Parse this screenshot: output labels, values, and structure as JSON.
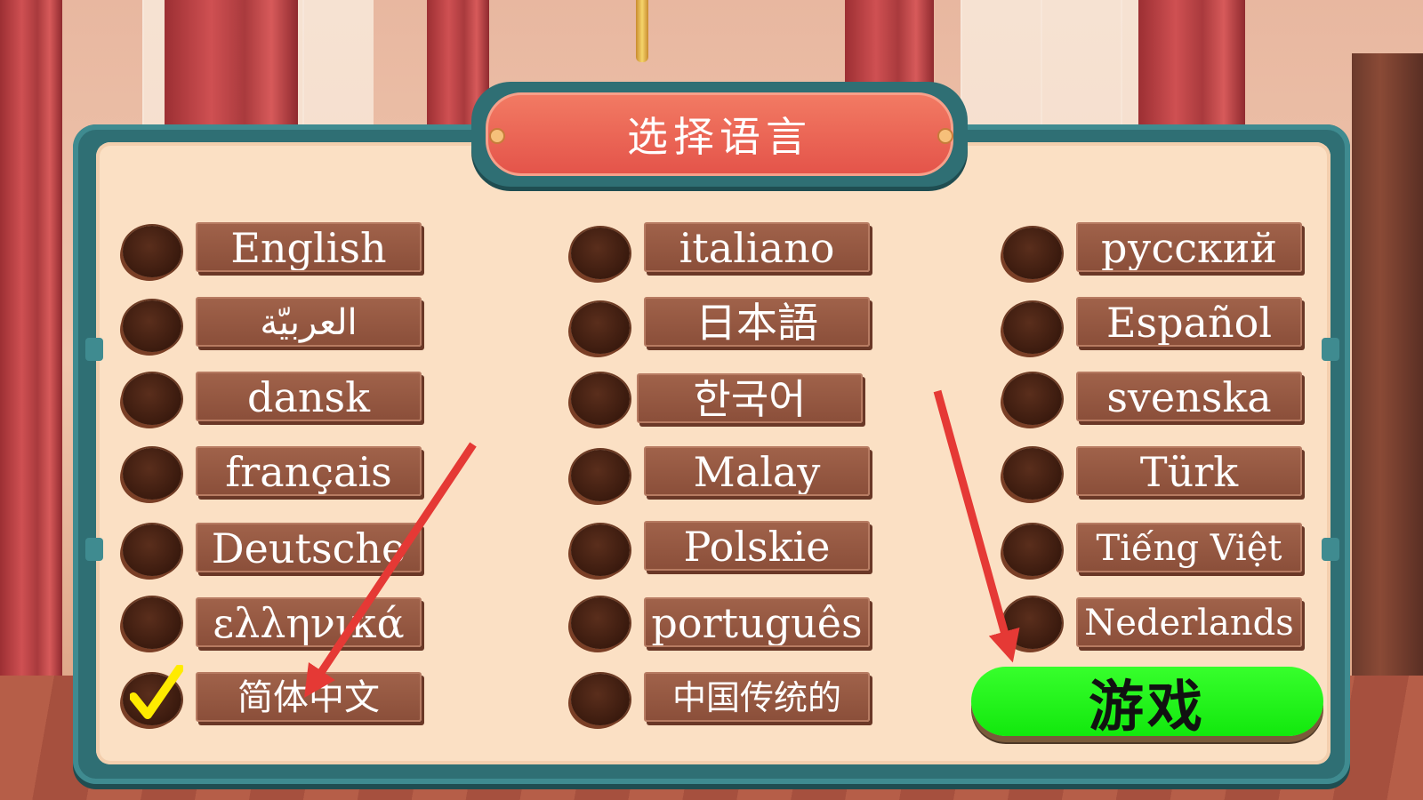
{
  "title": "选择语言",
  "languages": {
    "col1": [
      "English",
      "العربيّة",
      "dansk",
      "français",
      "Deutsche",
      "ελληνικά",
      "简体中文"
    ],
    "col2": [
      "italiano",
      "日本語",
      "한국어",
      "Malay",
      "Polskie",
      "português",
      "中国传统的"
    ],
    "col3": [
      "русский",
      "Español",
      "svenska",
      "Türk",
      "Tiếng Việt",
      "Nederlands"
    ]
  },
  "selected_language": "简体中文",
  "play_button_label": "游戏",
  "colors": {
    "board_frame": "#2f6f74",
    "board_fill": "#fbe0c4",
    "label_bg": "#8b4f3a",
    "radio": "#3a1a0e",
    "play_button": "#22f21a",
    "banner": "#e4544a",
    "check": "#ffeb00",
    "arrow": "#e53935"
  }
}
